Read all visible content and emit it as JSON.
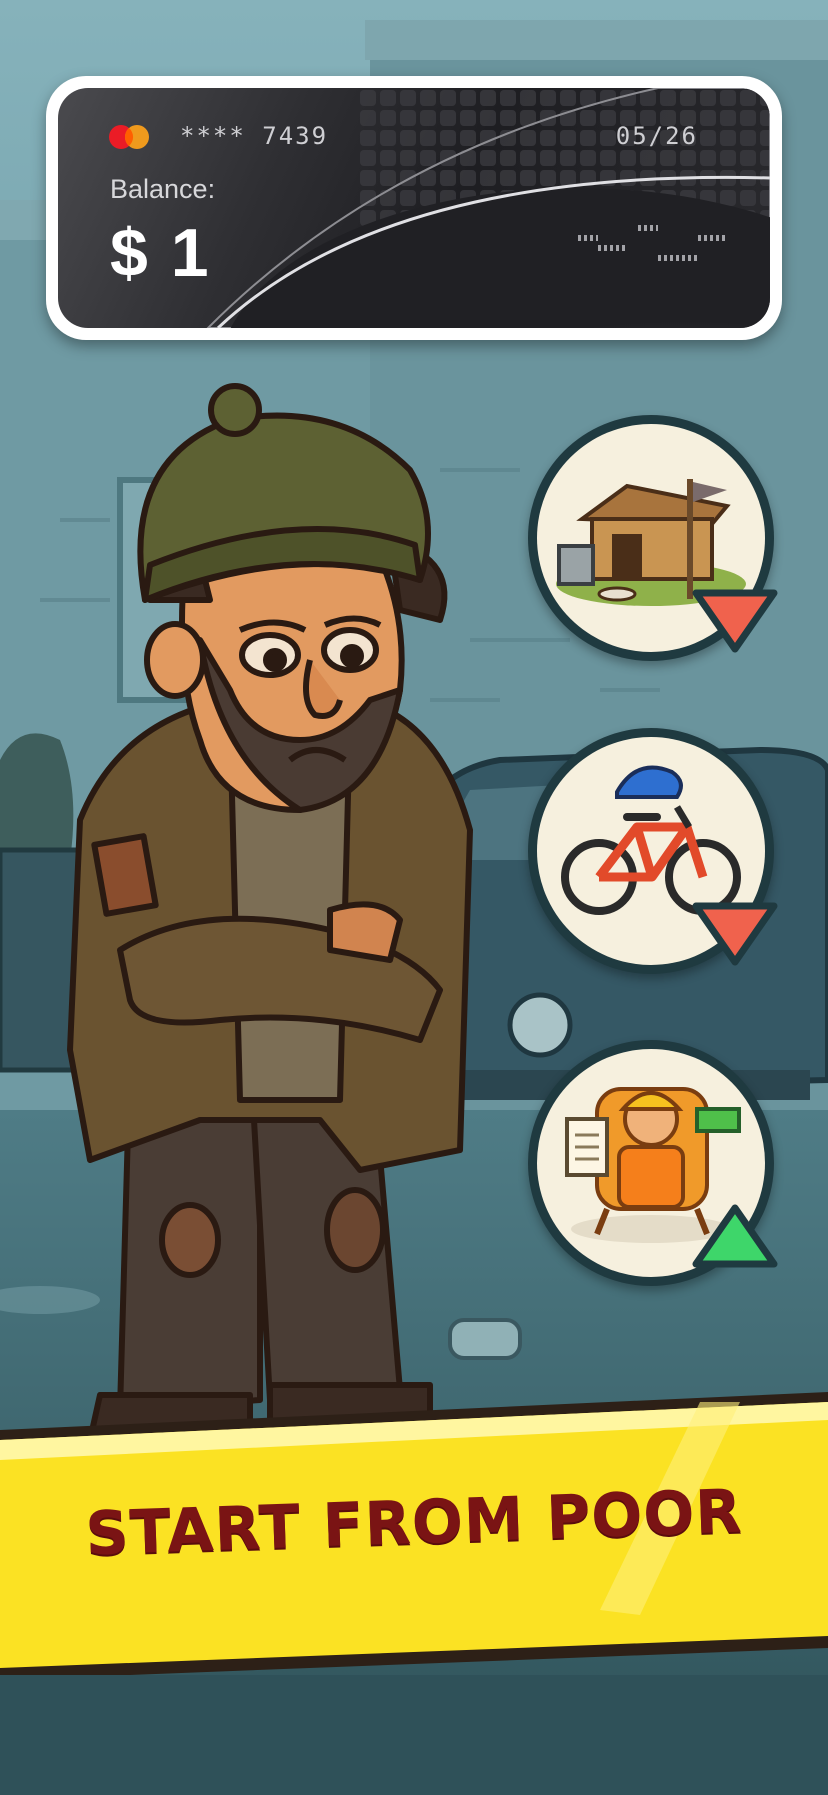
{
  "card": {
    "number_masked": "**** 7439",
    "expiry": "05/26",
    "balance_label": "Balance:",
    "balance_value": "$ 1",
    "logo": "mastercard-logo"
  },
  "levels": [
    {
      "name": "doghouse-shack",
      "trend": "down",
      "trend_color": "#f0624d"
    },
    {
      "name": "bicycle-with-helmet",
      "trend": "down",
      "trend_color": "#f0624d"
    },
    {
      "name": "delivery-worker",
      "trend": "up",
      "trend_color": "#3ed66a"
    }
  ],
  "banner": {
    "text": "START FROM POOR",
    "background": "#fbe223",
    "text_color": "#7a1414"
  }
}
